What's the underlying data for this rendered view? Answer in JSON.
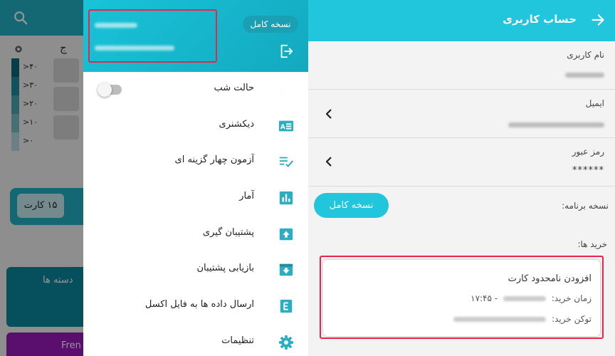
{
  "background_app": {
    "column_letter": "ج",
    "legend": [
      ">۴۰",
      ">۳۰",
      ">۲۰",
      ">۱۰",
      ">۰"
    ],
    "legend_colors": [
      "#0c6a7a",
      "#1f8e9c",
      "#4aa7b2",
      "#7cc1c8",
      "#b8dde1"
    ],
    "cards_button": "۱۵ کارت",
    "groups_label": "دسته ها",
    "french_label": "Fren"
  },
  "drawer": {
    "premium_badge": "نسخه کامل",
    "items": [
      {
        "label": "حالت شب",
        "icon": "moon-icon"
      },
      {
        "label": "دیکشنری",
        "icon": "dictionary-icon"
      },
      {
        "label": "آزمون چهار گزینه ای",
        "icon": "checklist-icon"
      },
      {
        "label": "آمار",
        "icon": "stats-icon"
      },
      {
        "label": "پشتیبان گیری",
        "icon": "backup-upload-icon"
      },
      {
        "label": "بازیابی پشتیبان",
        "icon": "restore-download-icon"
      },
      {
        "label": "ارسال داده ها به فایل اکسل",
        "icon": "excel-icon"
      },
      {
        "label": "تنظیمات",
        "icon": "gear-icon"
      }
    ],
    "night_mode_on": false
  },
  "account": {
    "title": "حساب کاربری",
    "username_label": "نام کاربری",
    "email_label": "ایمیل",
    "password_label": "رمز عبور",
    "password_value": "******",
    "version_label": "نسخه برنامه:",
    "version_button": "نسخه کامل",
    "purchases_label": "خرید ها:",
    "purchase": {
      "title": "افزودن نامحدود کارت",
      "time_label": "زمان خرید:",
      "time_value": "- ۱۷:۴۵",
      "token_label": "توکن خرید:"
    }
  },
  "colors": {
    "accent": "#22c6dc",
    "highlight": "#e8264a"
  }
}
